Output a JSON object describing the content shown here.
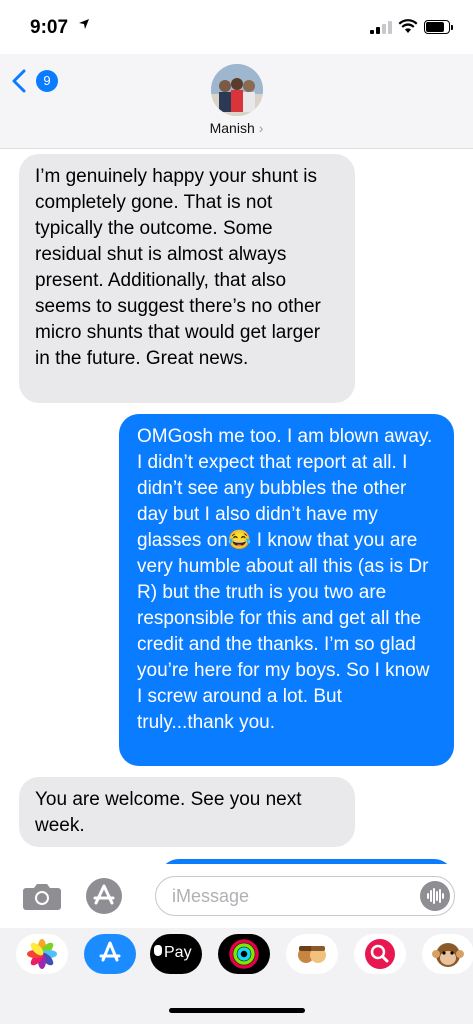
{
  "status_bar": {
    "time": "9:07",
    "location_icon": "location-arrow-icon"
  },
  "header": {
    "back_count": "9",
    "contact_name": "Manish",
    "chevron": "›"
  },
  "messages": [
    {
      "direction": "incoming",
      "text": "I’m genuinely happy your shunt is completely gone. That is not typically the outcome. Some residual shut is almost always present. Additionally, that also seems to suggest there’s no other micro shunts that would get larger in the future. Great news."
    },
    {
      "direction": "outgoing",
      "text": "OMGosh me too. I am blown away. I didn’t expect that report at all. I didn’t see any bubbles the other day but I also didn’t have my glasses on😂 I know that you are very humble about all this (as is Dr R) but the truth is you two are responsible for this and get all the credit and the thanks. I’m so glad you’re here for my boys. So I know I screw around a lot. But truly...thank you."
    },
    {
      "direction": "incoming",
      "text": "You are welcome. See you next week."
    }
  ],
  "compose": {
    "placeholder": "iMessage"
  },
  "app_drawer": {
    "items": [
      "Photos",
      "App Store",
      "Pay",
      "Activity",
      "Memoji",
      "Search",
      "Animoji"
    ],
    "pay_label": "Pay"
  },
  "colors": {
    "accent": "#0a7cff",
    "incoming_bubble": "#e9e9eb"
  }
}
